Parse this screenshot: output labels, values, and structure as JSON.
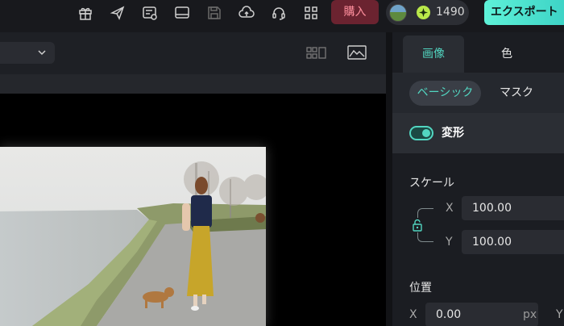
{
  "toolbar": {
    "icons": [
      "gift-icon",
      "send-icon",
      "task-list-icon",
      "screen-icon",
      "save-icon",
      "cloud-upload-icon",
      "headset-icon",
      "grid-icon"
    ],
    "buy_label": "購入",
    "credits": "1490",
    "export_label": "エクスポート"
  },
  "preview": {
    "background": "#000000"
  },
  "inspector": {
    "tabs": [
      "画像",
      "色"
    ],
    "subtabs": [
      "ベーシック",
      "マスク"
    ],
    "section_title": "変形",
    "scale": {
      "label": "スケール",
      "x_label": "X",
      "x_value": "100.00",
      "y_label": "Y",
      "y_value": "100.00"
    },
    "position": {
      "label": "位置",
      "x_label": "X",
      "x_value": "0.00",
      "x_unit": "px",
      "y_label": "Y"
    }
  },
  "colors": {
    "accent": "#52d6c1",
    "buy_bg": "#6b2330",
    "buy_text": "#ff8f9d",
    "export_gradient": [
      "#5ef2d8",
      "#3ad0c4"
    ]
  }
}
